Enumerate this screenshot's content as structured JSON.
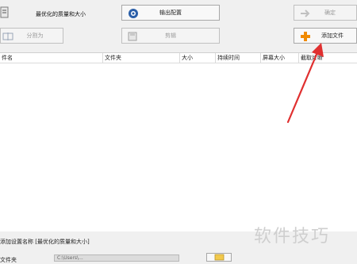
{
  "toolbar": {
    "quality_label": "最优化的质量和大小",
    "output_config_label": "输出配置",
    "confirm_label": "确定",
    "split_label": "分割为",
    "edit_label": "剪辑",
    "add_file_label": "添加文件"
  },
  "file_list": {
    "columns": [
      "件名",
      "文件夹",
      "大小",
      "持续时间",
      "屏幕大小",
      "截取片断"
    ]
  },
  "settings": {
    "preset_text": "添加设置名称 [最优化的质量和大小]",
    "folder_label": "文件夹",
    "folder_value": "C:\\Users\\..."
  },
  "watermark": "软件技巧",
  "colors": {
    "annotation_arrow": "#e03030",
    "add_plus": "#f08a00"
  }
}
